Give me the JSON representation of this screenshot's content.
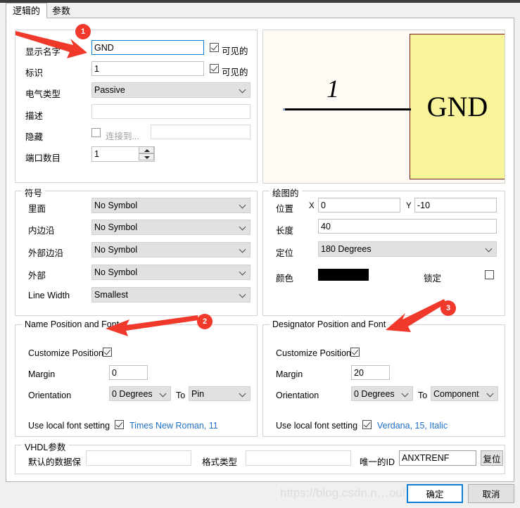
{
  "window": {
    "tabs": [
      {
        "label": "逻辑的",
        "active": true
      },
      {
        "label": "参数",
        "active": false
      }
    ]
  },
  "logical": {
    "display_name_label": "显示名字",
    "display_name_value": "GND",
    "display_name_visible_label": "可见的",
    "designator_label": "标识",
    "designator_value": "1",
    "designator_visible_label": "可见的",
    "electrical_type_label": "电气类型",
    "electrical_type_value": "Passive",
    "description_label": "描述",
    "description_value": "",
    "hide_label": "隐藏",
    "connect_to_label": "连接到...",
    "connect_to_value": "",
    "port_count_label": "端口数目",
    "port_count_value": "1"
  },
  "preview": {
    "designator_text": "1",
    "name_text": "GND",
    "highlight_color": "#f7f49a",
    "highlight_border_color": "#7a1b1b",
    "background_color": "#fffaf4"
  },
  "symbol": {
    "legend": "符号",
    "rows": [
      {
        "label": "里面",
        "value": "No Symbol"
      },
      {
        "label": "内边沿",
        "value": "No Symbol"
      },
      {
        "label": "外部边沿",
        "value": "No Symbol"
      },
      {
        "label": "外部",
        "value": "No Symbol"
      },
      {
        "label": "Line Width",
        "value": "Smallest"
      }
    ]
  },
  "drawing": {
    "legend": "绘图的",
    "position_label": "位置",
    "x_label": "X",
    "x_value": "0",
    "y_label": "Y",
    "y_value": "-10",
    "length_label": "长度",
    "length_value": "40",
    "orientation_label": "定位",
    "orientation_value": "180 Degrees",
    "color_label": "颜色",
    "color_value": "#000000",
    "locked_label": "锁定"
  },
  "name_font": {
    "legend": "Name Position and Font",
    "customize_position_label": "Customize Position",
    "margin_label": "Margin",
    "margin_value": "0",
    "orientation_label": "Orientation",
    "orientation_value": "0 Degrees",
    "to_label": "To",
    "to_value": "Pin",
    "use_local_font_label": "Use local font setting",
    "font_value": "Times New Roman, 11"
  },
  "designator_font": {
    "legend": "Designator Position and Font",
    "customize_position_label": "Customize Position",
    "margin_label": "Margin",
    "margin_value": "20",
    "orientation_label": "Orientation",
    "orientation_value": "0 Degrees",
    "to_label": "To",
    "to_value": "Component",
    "use_local_font_label": "Use local font setting",
    "font_value": "Verdana, 15, Italic"
  },
  "vhdl": {
    "legend": "VHDL参数",
    "default_data_label": "默认的数据保",
    "default_data_value": "",
    "format_type_label": "格式类型",
    "format_type_value": "",
    "unique_id_label": "唯一的ID",
    "unique_id_value": "ANXTRENF",
    "reset_label": "复位"
  },
  "footer": {
    "ok_label": "确定",
    "cancel_label": "取消",
    "watermark": "https://blog.csdn.n…oul_mat…hao"
  },
  "annotations": [
    {
      "badge": "1"
    },
    {
      "badge": "2"
    },
    {
      "badge": "3"
    }
  ]
}
